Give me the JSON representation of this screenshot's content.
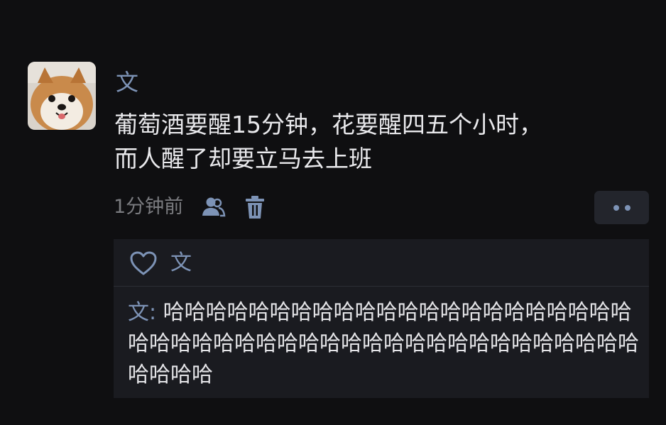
{
  "post": {
    "avatar_icon": "shiba-dog-avatar",
    "author": "文",
    "text": "葡萄酒要醒15分钟，花要醒四五个小时，\n而人醒了却要立马去上班",
    "timestamp": "1分钟前",
    "visibility_icon": "people-icon",
    "delete_icon": "trash-icon",
    "more_icon": "more-dots-icon"
  },
  "interactions": {
    "like_icon": "heart-icon",
    "liked_by": "文",
    "comments": [
      {
        "author": "文",
        "separator": ": ",
        "text": "哈哈哈哈哈哈哈哈哈哈哈哈哈哈哈哈哈哈哈哈哈哈哈哈哈哈哈哈哈哈哈哈哈哈哈哈哈哈哈哈哈哈哈哈哈哈哈哈哈哈"
      }
    ]
  },
  "colors": {
    "background": "#0f0f11",
    "name_blue": "#7d93b6",
    "text": "#e9e9ec",
    "muted": "#7a7b7f",
    "panel": "#1a1b20"
  }
}
